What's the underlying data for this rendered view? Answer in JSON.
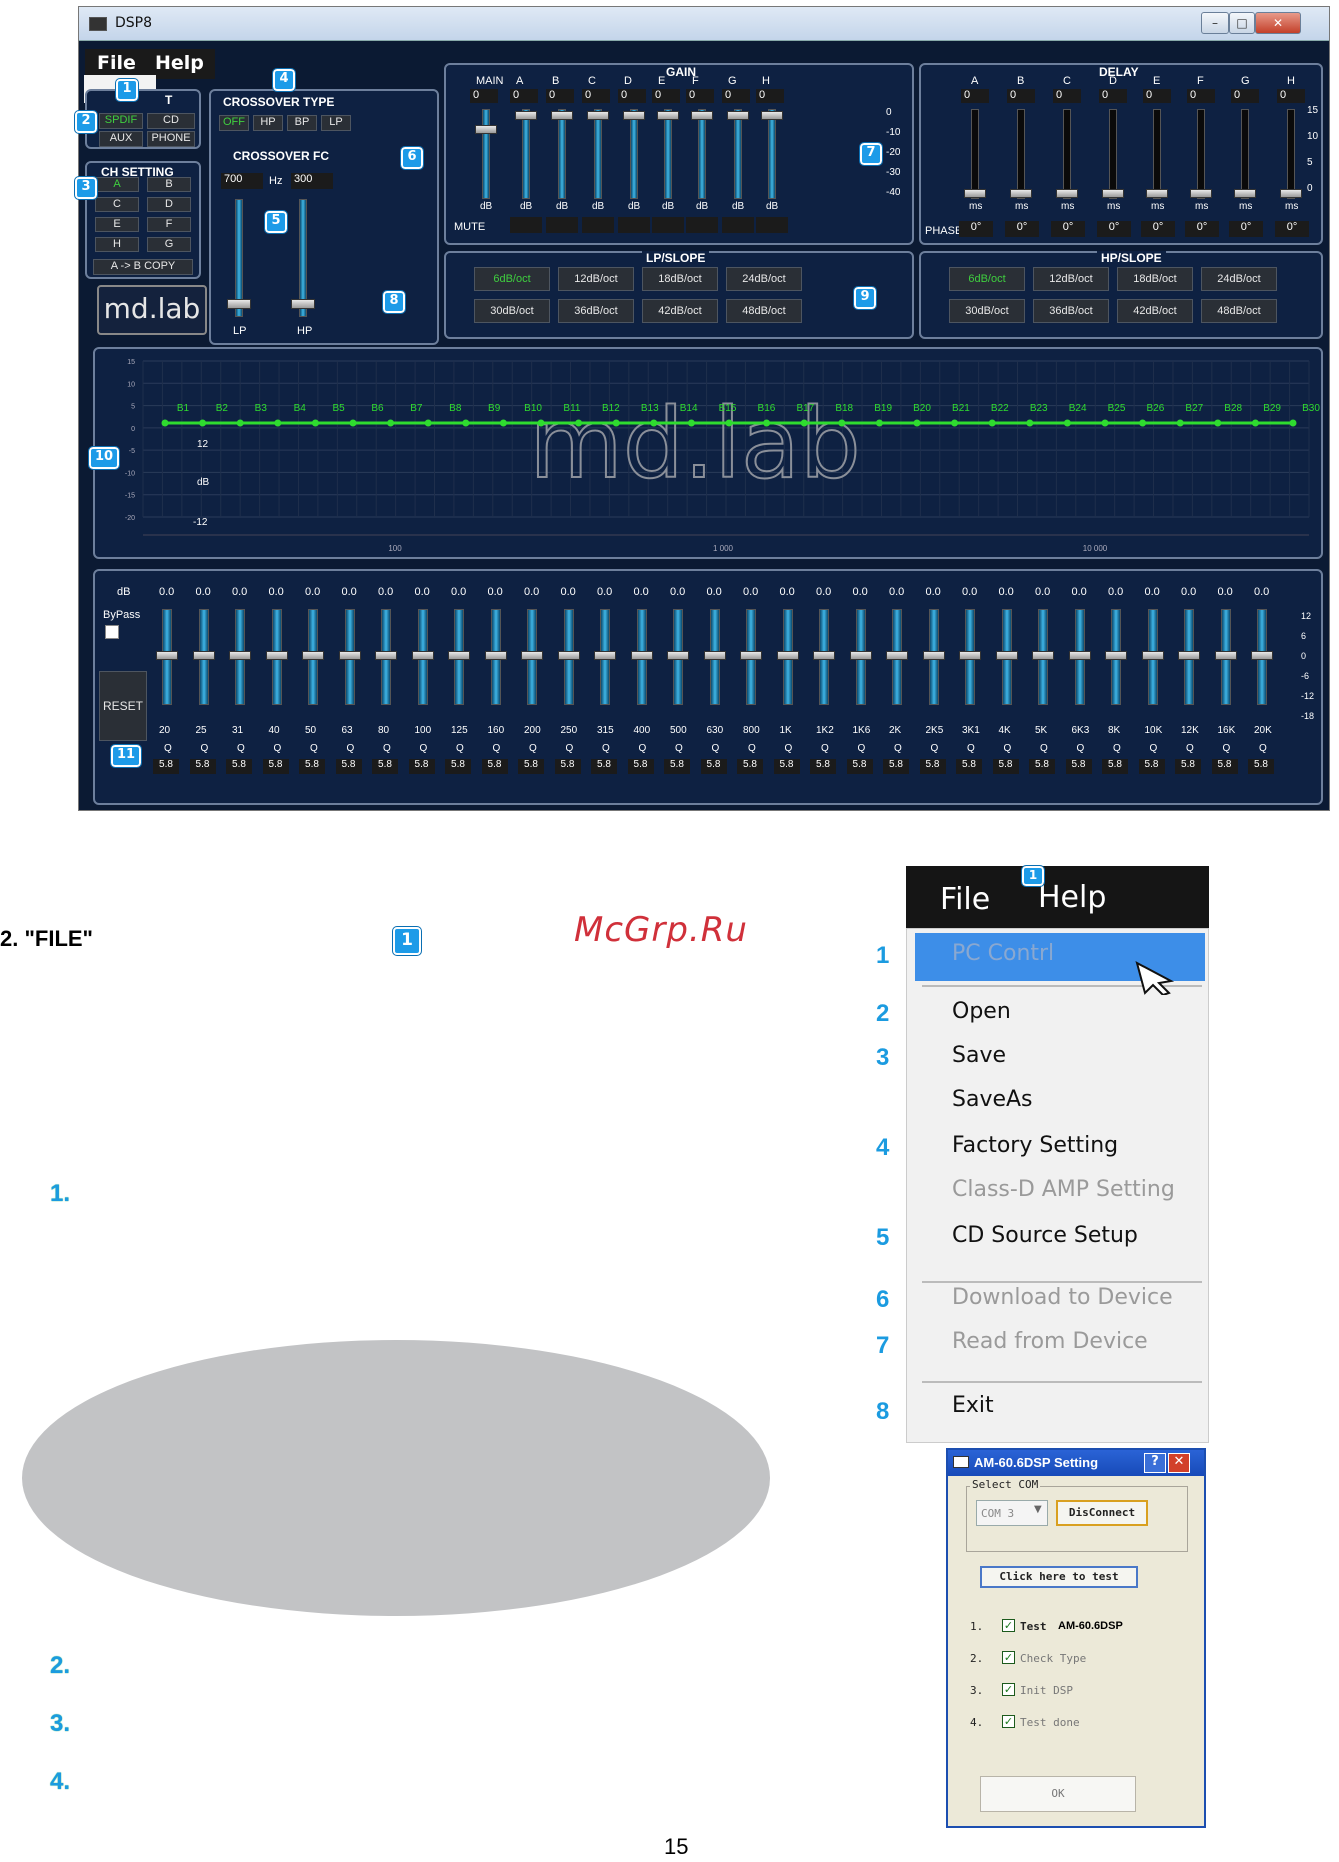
{
  "window": {
    "title": "DSP8",
    "menu": {
      "file": "File",
      "help": "Help"
    },
    "input": {
      "header": "T",
      "buttons": [
        "SPDIF",
        "CD",
        "AUX",
        "PHONE"
      ]
    },
    "ch_setting": {
      "title": "CH SETTING",
      "channels": [
        "A",
        "B",
        "C",
        "D",
        "E",
        "F",
        "H",
        "G"
      ],
      "copy": "A -> B COPY"
    },
    "logo": "md.lab",
    "crossover": {
      "type_title": "CROSSOVER TYPE",
      "types": [
        "OFF",
        "HP",
        "BP",
        "LP"
      ],
      "fc_title": "CROSSOVER FC",
      "lp_value": "700",
      "unit": "Hz",
      "hp_value": "300",
      "lp_label": "LP",
      "hp_label": "HP"
    },
    "gain": {
      "title": "GAIN",
      "channels": [
        "MAIN",
        "A",
        "B",
        "C",
        "D",
        "E",
        "F",
        "G",
        "H"
      ],
      "values": [
        "0",
        "0",
        "0",
        "0",
        "0",
        "0",
        "0",
        "0",
        "0"
      ],
      "unit": "dB",
      "mute": "MUTE",
      "scale": [
        "0",
        "-10",
        "-20",
        "-30",
        "-40"
      ]
    },
    "delay": {
      "title": "DELAY",
      "channels": [
        "A",
        "B",
        "C",
        "D",
        "E",
        "F",
        "G",
        "H"
      ],
      "values": [
        "0",
        "0",
        "0",
        "0",
        "0",
        "0",
        "0",
        "0"
      ],
      "unit": "ms",
      "phase": "PHASE",
      "phase_values": [
        "0°",
        "0°",
        "0°",
        "0°",
        "0°",
        "0°",
        "0°",
        "0°"
      ],
      "scale": [
        "15",
        "10",
        "5",
        "0"
      ]
    },
    "lp_slope": {
      "title": "LP/SLOPE",
      "buttons": [
        "6dB/oct",
        "12dB/oct",
        "18dB/oct",
        "24dB/oct",
        "30dB/oct",
        "36dB/oct",
        "42dB/oct",
        "48dB/oct"
      ]
    },
    "hp_slope": {
      "title": "HP/SLOPE",
      "buttons": [
        "6dB/oct",
        "12dB/oct",
        "18dB/oct",
        "24dB/oct",
        "30dB/oct",
        "36dB/oct",
        "42dB/oct",
        "48dB/oct"
      ]
    },
    "graph": {
      "bands": [
        "B1",
        "B2",
        "B3",
        "B4",
        "B5",
        "B6",
        "B7",
        "B8",
        "B9",
        "B10",
        "B11",
        "B12",
        "B13",
        "B14",
        "B15",
        "B16",
        "B17",
        "B18",
        "B19",
        "B20",
        "B21",
        "B22",
        "B23",
        "B24",
        "B25",
        "B26",
        "B27",
        "B28",
        "B29",
        "B30"
      ],
      "yticks": [
        "15",
        "10",
        "5",
        "0",
        "-5",
        "-10",
        "-15",
        "-20"
      ],
      "inner_labels": [
        "12",
        "dB",
        "-12"
      ],
      "xticks": [
        "100",
        "1 000",
        "10 000"
      ],
      "watermark": "md.lab"
    },
    "eq": {
      "db_label": "dB",
      "db_values": [
        "0.0",
        "0.0",
        "0.0",
        "0.0",
        "0.0",
        "0.0",
        "0.0",
        "0.0",
        "0.0",
        "0.0",
        "0.0",
        "0.0",
        "0.0",
        "0.0",
        "0.0",
        "0.0",
        "0.0",
        "0.0",
        "0.0",
        "0.0",
        "0.0",
        "0.0",
        "0.0",
        "0.0",
        "0.0",
        "0.0",
        "0.0",
        "0.0",
        "0.0",
        "0.0",
        "0.0"
      ],
      "bypass": "ByPass",
      "reset": "RESET",
      "freqs": [
        "20",
        "25",
        "31",
        "40",
        "50",
        "63",
        "80",
        "100",
        "125",
        "160",
        "200",
        "250",
        "315",
        "400",
        "500",
        "630",
        "800",
        "1K",
        "1K2",
        "1K6",
        "2K",
        "2K5",
        "3K1",
        "4K",
        "5K",
        "6K3",
        "8K",
        "10K",
        "12K",
        "16K",
        "20K"
      ],
      "q_label": "Q",
      "q_values": [
        "5.8",
        "5.8",
        "5.8",
        "5.8",
        "5.8",
        "5.8",
        "5.8",
        "5.8",
        "5.8",
        "5.8",
        "5.8",
        "5.8",
        "5.8",
        "5.8",
        "5.8",
        "5.8",
        "5.8",
        "5.8",
        "5.8",
        "5.8",
        "5.8",
        "5.8",
        "5.8",
        "5.8",
        "5.8",
        "5.8",
        "5.8",
        "5.8",
        "5.8",
        "5.8",
        "5.8"
      ],
      "scale": [
        "12",
        "6",
        "0",
        "-6",
        "-12",
        "-18"
      ]
    },
    "badges": [
      "1",
      "2",
      "3",
      "4",
      "5",
      "6",
      "7",
      "8",
      "9",
      "10",
      "11"
    ]
  },
  "page": {
    "section_heading": "2.  \"FILE\"",
    "section_badge": "1",
    "watermark": "McGrp.Ru",
    "items": [
      "1.",
      "2.",
      "3.",
      "4."
    ],
    "page_number": "15"
  },
  "file_menu": {
    "file": "File",
    "help": "Help",
    "badge": "1",
    "items": [
      {
        "num": "1",
        "label": "PC Contrl",
        "state": "highlighted"
      },
      {
        "num": "2",
        "label": "Open",
        "state": "enabled"
      },
      {
        "num": "3",
        "label": "Save",
        "state": "enabled"
      },
      {
        "num": "",
        "label": "SaveAs",
        "state": "enabled"
      },
      {
        "num": "4",
        "label": "Factory Setting",
        "state": "enabled"
      },
      {
        "num": "",
        "label": "Class-D AMP Setting",
        "state": "disabled"
      },
      {
        "num": "5",
        "label": "CD Source Setup",
        "state": "enabled"
      },
      {
        "num": "6",
        "label": "Download to Device",
        "state": "disabled"
      },
      {
        "num": "7",
        "label": "Read from Device",
        "state": "disabled"
      },
      {
        "num": "8",
        "label": "Exit",
        "state": "enabled"
      }
    ]
  },
  "dialog": {
    "title": "AM-60.6DSP Setting",
    "help_btn": "?",
    "close_btn": "✕",
    "group": "Select COM",
    "com": "COM 3",
    "disconnect": "DisConnect",
    "test_btn": "Click here to test",
    "steps": [
      {
        "num": "1.",
        "label": "Test",
        "extra": "AM-60.6DSP"
      },
      {
        "num": "2.",
        "label": "Check Type",
        "extra": ""
      },
      {
        "num": "3.",
        "label": "Init DSP",
        "extra": ""
      },
      {
        "num": "4.",
        "label": "Test done",
        "extra": ""
      }
    ],
    "ok": "OK"
  },
  "colors": {
    "accent": "#1b9be0",
    "active": "#3fcf3f",
    "panel": "#0e2142",
    "curve": "#2fdc2f"
  }
}
